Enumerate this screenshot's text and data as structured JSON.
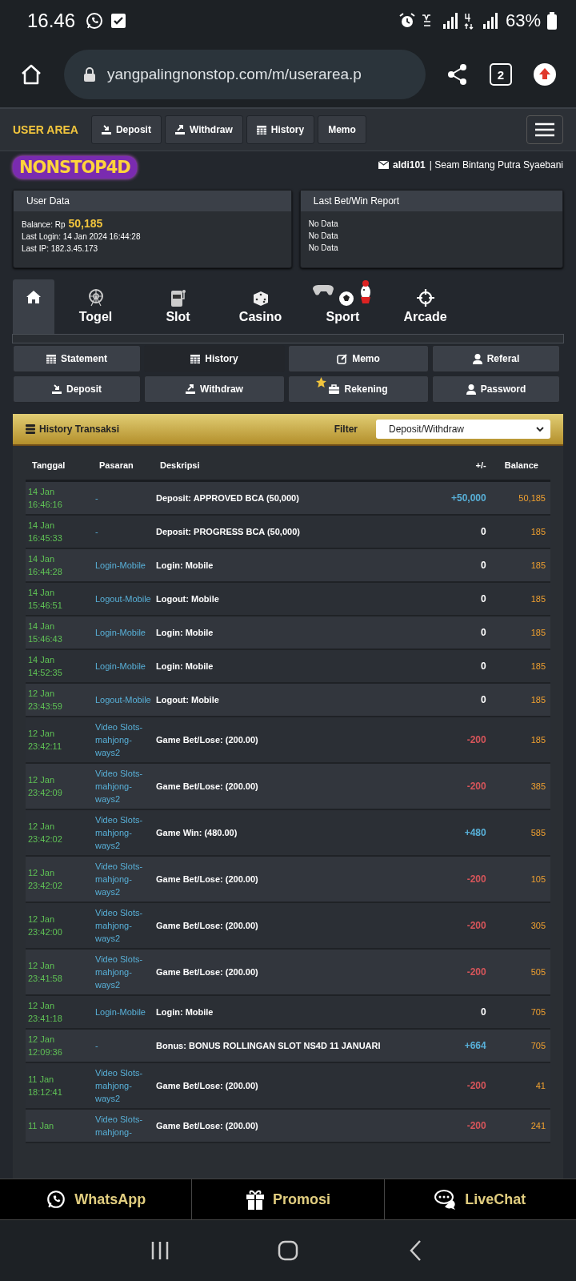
{
  "status_bar": {
    "time": "16.46",
    "battery": "63%"
  },
  "browser": {
    "url": "yangpalingnonstop.com/m/userarea.p",
    "tab_count": "2"
  },
  "header": {
    "title": "USER AREA",
    "buttons": [
      {
        "label": "Deposit"
      },
      {
        "label": "Withdraw"
      },
      {
        "label": "History"
      },
      {
        "label": "Memo"
      }
    ]
  },
  "logo": "NONSTOP4D",
  "user": {
    "username": "aldi101",
    "name": "| Seam Bintang Putra Syaebani"
  },
  "user_data": {
    "title": "User Data",
    "balance_label": "Balance: Rp",
    "balance": "50,185",
    "last_login": "Last Login: 14 Jan 2024 16:44:28",
    "last_ip": "Last IP: 182.3.45.173"
  },
  "last_bet": {
    "title": "Last Bet/Win Report",
    "lines": [
      "No Data",
      "No Data",
      "No Data"
    ]
  },
  "game_tabs": [
    {
      "selected": true
    },
    {
      "label": "Togel",
      "selected": false
    },
    {
      "label": "Slot",
      "selected": false
    },
    {
      "label": "Casino",
      "selected": false
    },
    {
      "label": "Sport",
      "selected": false
    },
    {
      "label": "Arcade",
      "selected": false
    }
  ],
  "menu": [
    {
      "label": "Statement",
      "selected": false
    },
    {
      "label": "History",
      "selected": true
    },
    {
      "label": "Memo",
      "selected": false
    },
    {
      "label": "Referal",
      "selected": false
    },
    {
      "label": "Deposit",
      "selected": false
    },
    {
      "label": "Withdraw",
      "selected": false
    },
    {
      "label": "Rekening",
      "selected": false
    },
    {
      "label": "Password",
      "selected": false
    }
  ],
  "history": {
    "title": "History Transaksi",
    "filter_label": "Filter",
    "filter_value": "Deposit/Withdraw",
    "columns": [
      "Tanggal",
      "Pasaran",
      "Deskripsi",
      "+/-",
      "Balance"
    ],
    "rows": [
      {
        "date": "14 Jan",
        "time": "16:46:16",
        "pasaran": "-",
        "description": "Deposit: APPROVED BCA (50,000)",
        "change": "+50,000",
        "color": "#58b0d8",
        "balance": "50,185"
      },
      {
        "date": "14 Jan",
        "time": "16:45:33",
        "pasaran": "-",
        "description": "Deposit: PROGRESS BCA (50,000)",
        "change": "0",
        "color": "#ffffff",
        "balance": "185"
      },
      {
        "date": "14 Jan",
        "time": "16:44:28",
        "pasaran": "Login-Mobile",
        "description": "Login: Mobile",
        "change": "0",
        "color": "#ffffff",
        "balance": "185"
      },
      {
        "date": "14 Jan",
        "time": "15:46:51",
        "pasaran": "Logout-Mobile",
        "description": "Logout: Mobile",
        "change": "0",
        "color": "#ffffff",
        "balance": "185"
      },
      {
        "date": "14 Jan",
        "time": "15:46:43",
        "pasaran": "Login-Mobile",
        "description": "Login: Mobile",
        "change": "0",
        "color": "#ffffff",
        "balance": "185"
      },
      {
        "date": "14 Jan",
        "time": "14:52:35",
        "pasaran": "Login-Mobile",
        "description": "Login: Mobile",
        "change": "0",
        "color": "#ffffff",
        "balance": "185"
      },
      {
        "date": "12 Jan",
        "time": "23:43:59",
        "pasaran": "Logout-Mobile",
        "description": "Logout: Mobile",
        "change": "0",
        "color": "#ffffff",
        "balance": "185"
      },
      {
        "date": "12 Jan",
        "time": "23:42:11",
        "pasaran": "Video Slots-mahjong-ways2",
        "description": "Game Bet/Lose: (200.00)",
        "change": "-200",
        "color": "#d6555a",
        "balance": "185"
      },
      {
        "date": "12 Jan",
        "time": "23:42:09",
        "pasaran": "Video Slots-mahjong-ways2",
        "description": "Game Bet/Lose: (200.00)",
        "change": "-200",
        "color": "#d6555a",
        "balance": "385"
      },
      {
        "date": "12 Jan",
        "time": "23:42:02",
        "pasaran": "Video Slots-mahjong-ways2",
        "description": "Game Win: (480.00)",
        "change": "+480",
        "color": "#58b0d8",
        "balance": "585"
      },
      {
        "date": "12 Jan",
        "time": "23:42:02",
        "pasaran": "Video Slots-mahjong-ways2",
        "description": "Game Bet/Lose: (200.00)",
        "change": "-200",
        "color": "#d6555a",
        "balance": "105"
      },
      {
        "date": "12 Jan",
        "time": "23:42:00",
        "pasaran": "Video Slots-mahjong-ways2",
        "description": "Game Bet/Lose: (200.00)",
        "change": "-200",
        "color": "#d6555a",
        "balance": "305"
      },
      {
        "date": "12 Jan",
        "time": "23:41:58",
        "pasaran": "Video Slots-mahjong-ways2",
        "description": "Game Bet/Lose: (200.00)",
        "change": "-200",
        "color": "#d6555a",
        "balance": "505"
      },
      {
        "date": "12 Jan",
        "time": "23:41:18",
        "pasaran": "Login-Mobile",
        "description": "Login: Mobile",
        "change": "0",
        "color": "#ffffff",
        "balance": "705"
      },
      {
        "date": "12 Jan",
        "time": "12:09:36",
        "pasaran": "-",
        "description": "Bonus: BONUS ROLLINGAN SLOT NS4D 11 JANUARI",
        "change": "+664",
        "color": "#58b0d8",
        "balance": "705"
      },
      {
        "date": "11 Jan",
        "time": "18:12:41",
        "pasaran": "Video Slots-mahjong-ways2",
        "description": "Game Bet/Lose: (200.00)",
        "change": "-200",
        "color": "#d6555a",
        "balance": "41"
      },
      {
        "date": "11 Jan",
        "pasaran": "Video Slots-mahjong-",
        "description": "Game Bet/Lose: (200.00)",
        "change": "-200",
        "color": "#d6555a",
        "balance": "241"
      }
    ]
  },
  "bottom_bar": [
    {
      "label": "WhatsApp"
    },
    {
      "label": "Promosi"
    },
    {
      "label": "LiveChat"
    }
  ]
}
